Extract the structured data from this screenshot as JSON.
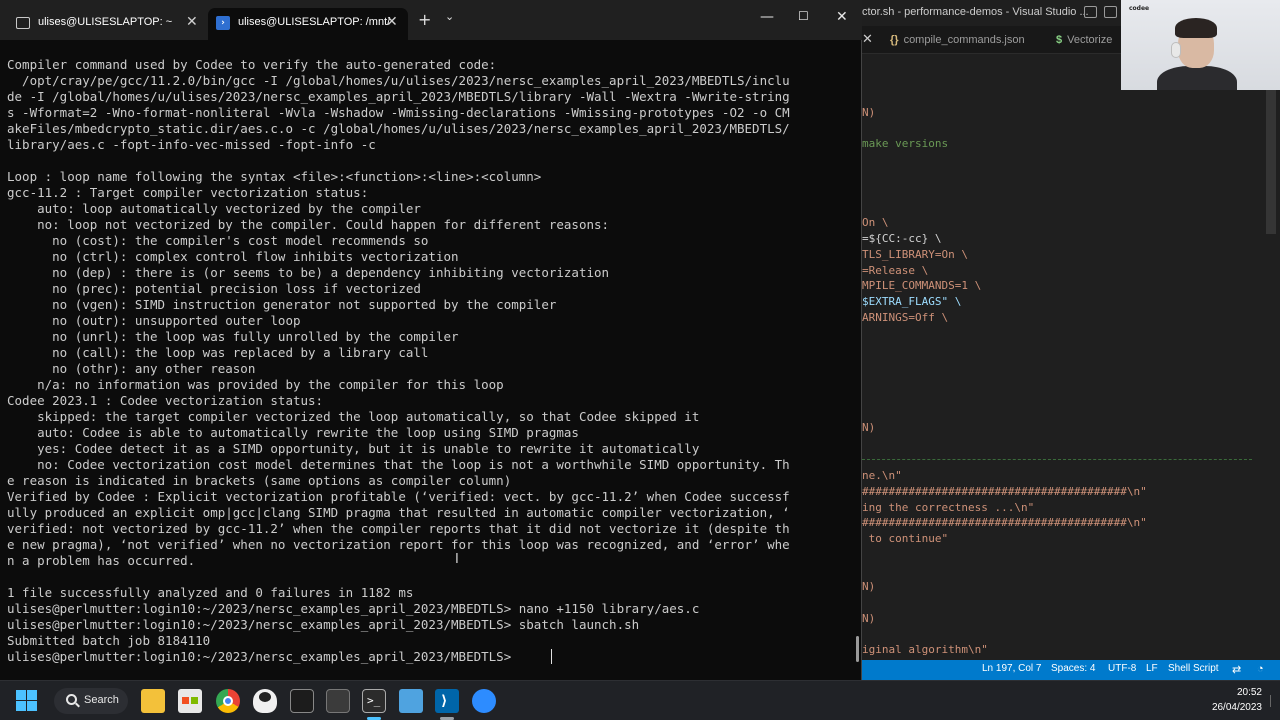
{
  "vscode": {
    "title": "ctor.sh - performance-demos - Visual Studio ...",
    "tabs": [
      {
        "label": "compile_commands.json",
        "glyph": "{}"
      },
      {
        "label": "Vectorize",
        "glyph": "$"
      }
    ],
    "code_lines": [
      {
        "text": "N)",
        "color": "orange"
      },
      {
        "text": "make versions",
        "color": "green"
      },
      {
        "text": "On \\",
        "color": "orange"
      },
      {
        "text": "=${CC:-cc} \\",
        "color": "white"
      },
      {
        "text": "TLS_LIBRARY=On \\",
        "color": "orange"
      },
      {
        "text": "=Release \\",
        "color": "orange"
      },
      {
        "text": "MPILE_COMMANDS=1 \\",
        "color": "orange"
      },
      {
        "text": "$EXTRA_FLAGS\" \\",
        "color": "lightblue"
      },
      {
        "text": "ARNINGS=Off \\",
        "color": "orange"
      },
      {
        "text": "N)",
        "color": "orange"
      },
      {
        "text": "ne.\\n\"",
        "color": "orange"
      },
      {
        "text": "########################################\\n\"",
        "color": "orange"
      },
      {
        "text": "ing the correctness ...\\n\"",
        "color": "orange"
      },
      {
        "text": "########################################\\n\"",
        "color": "orange"
      },
      {
        "text": " to continue\"",
        "color": "orange"
      },
      {
        "text": "N)",
        "color": "orange"
      },
      {
        "text": "N)",
        "color": "orange"
      },
      {
        "text": "iginal algorithm\\n\"",
        "color": "orange"
      }
    ],
    "status": {
      "position": "Ln 197, Col 7",
      "spaces": "Spaces: 4",
      "encoding": "UTF-8",
      "eol": "LF",
      "language": "Shell Script"
    }
  },
  "webcam": {
    "logo": "codee"
  },
  "terminal": {
    "tabs": [
      {
        "label": "ulises@ULISESLAPTOP: ~",
        "active": false
      },
      {
        "label": "ulises@ULISESLAPTOP: /mnt/",
        "active": true
      }
    ],
    "lines": [
      "Compiler command used by Codee to verify the auto-generated code:",
      "  /opt/cray/pe/gcc/11.2.0/bin/gcc -I /global/homes/u/ulises/2023/nersc_examples_april_2023/MBEDTLS/inclu",
      "de -I /global/homes/u/ulises/2023/nersc_examples_april_2023/MBEDTLS/library -Wall -Wextra -Wwrite-string",
      "s -Wformat=2 -Wno-format-nonliteral -Wvla -Wshadow -Wmissing-declarations -Wmissing-prototypes -O2 -o CM",
      "akeFiles/mbedcrypto_static.dir/aes.c.o -c /global/homes/u/ulises/2023/nersc_examples_april_2023/MBEDTLS/",
      "library/aes.c -fopt-info-vec-missed -fopt-info -c",
      "",
      "Loop : loop name following the syntax <file>:<function>:<line>:<column>",
      "gcc-11.2 : Target compiler vectorization status:",
      "    auto: loop automatically vectorized by the compiler",
      "    no: loop not vectorized by the compiler. Could happen for different reasons:",
      "      no (cost): the compiler's cost model recommends so",
      "      no (ctrl): complex control flow inhibits vectorization",
      "      no (dep) : there is (or seems to be) a dependency inhibiting vectorization",
      "      no (prec): potential precision loss if vectorized",
      "      no (vgen): SIMD instruction generator not supported by the compiler",
      "      no (outr): unsupported outer loop",
      "      no (unrl): the loop was fully unrolled by the compiler",
      "      no (call): the loop was replaced by a library call",
      "      no (othr): any other reason",
      "    n/a: no information was provided by the compiler for this loop",
      "Codee 2023.1 : Codee vectorization status:",
      "    skipped: the target compiler vectorized the loop automatically, so that Codee skipped it",
      "    auto: Codee is able to automatically rewrite the loop using SIMD pragmas",
      "    yes: Codee detect it as a SIMD opportunity, but it is unable to rewrite it automatically",
      "    no: Codee vectorization cost model determines that the loop is not a worthwhile SIMD opportunity. Th",
      "e reason is indicated in brackets (same options as compiler column)",
      "Verified by Codee : Explicit vectorization profitable (‘verified: vect. by gcc-11.2’ when Codee successf",
      "ully produced an explicit omp|gcc|clang SIMD pragma that resulted in automatic compiler vectorization, ‘",
      "verified: not vectorized by gcc-11.2’ when the compiler reports that it did not vectorize it (despite th",
      "e new pragma), ‘not verified’ when no vectorization report for this loop was recognized, and ‘error’ whe",
      "n a problem has occurred.",
      "",
      "1 file successfully analyzed and 0 failures in 1182 ms",
      "ulises@perlmutter:login10:~/2023/nersc_examples_april_2023/MBEDTLS> nano +1150 library/aes.c",
      "ulises@perlmutter:login10:~/2023/nersc_examples_april_2023/MBEDTLS> sbatch launch.sh",
      "Submitted batch job 8184110",
      "ulises@perlmutter:login10:~/2023/nersc_examples_april_2023/MBEDTLS> "
    ]
  },
  "taskbar": {
    "search_label": "Search",
    "time": "20:52",
    "date": "26/04/2023",
    "apps": [
      "file-explorer",
      "microsoft-store",
      "chrome",
      "linux-penguin",
      "terminal-app",
      "calculator",
      "windows-terminal",
      "notepad",
      "vscode",
      "zoom"
    ]
  }
}
